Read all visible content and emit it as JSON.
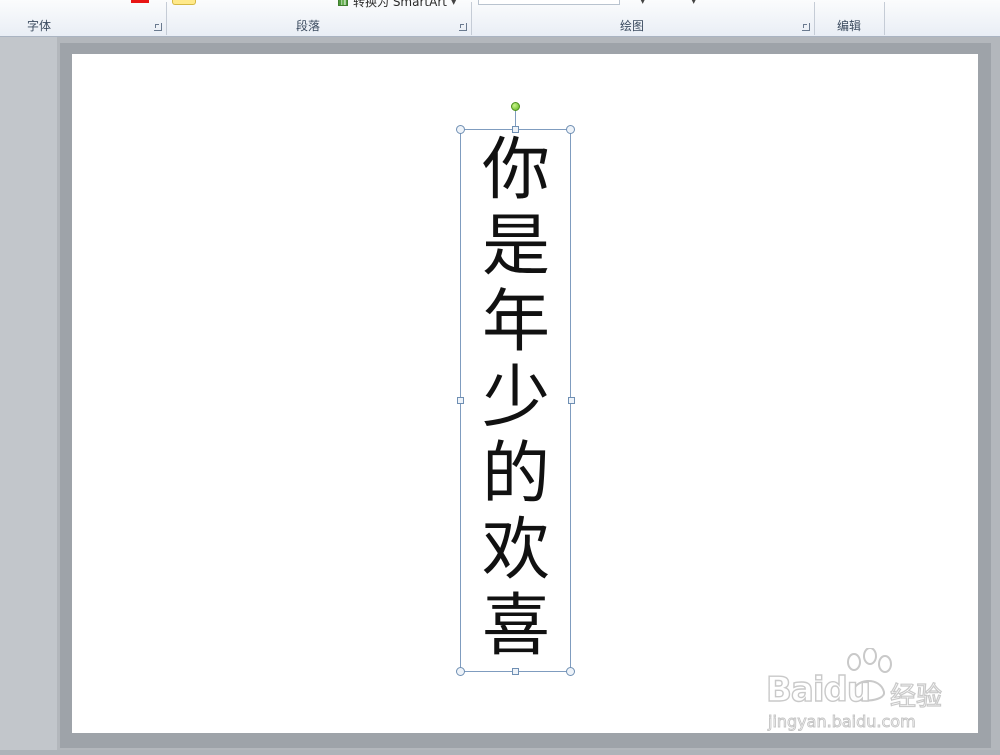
{
  "ribbon": {
    "groups": {
      "font": {
        "label": "字体"
      },
      "paragraph": {
        "label": "段落"
      },
      "drawing": {
        "label": "绘图"
      },
      "editing": {
        "label": "编辑"
      }
    },
    "smartart_label": "转换为 SmartArt",
    "font_color": "#e81515",
    "shape_fill_color": "#ffe98a"
  },
  "slide": {
    "textbox": {
      "characters": [
        "你",
        "是",
        "年",
        "少",
        "的",
        "欢",
        "喜"
      ]
    }
  },
  "watermark": {
    "logo": "Baidu",
    "jingyan": "经验",
    "url": "jingyan.baidu.com"
  }
}
